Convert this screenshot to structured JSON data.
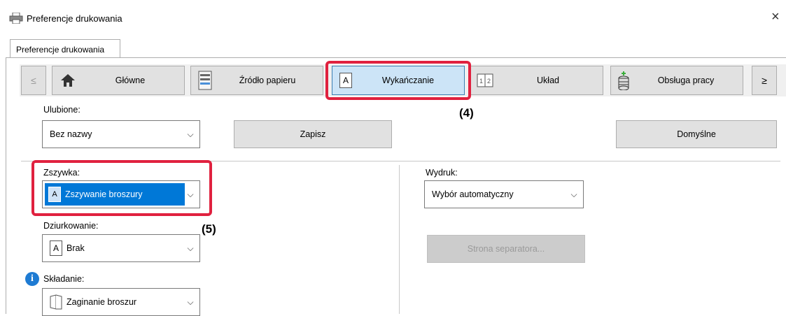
{
  "window": {
    "title": "Preferencje drukowania",
    "close_glyph": "×"
  },
  "tab": {
    "label": "Preferencje drukowania"
  },
  "nav": {
    "prev": "≤",
    "next": "≥",
    "items": [
      {
        "label": "Główne",
        "icon": "home-icon"
      },
      {
        "label": "Źródło papieru",
        "icon": "paper-tray-icon"
      },
      {
        "label": "Wykańczanie",
        "icon": "finishing-icon"
      },
      {
        "label": "Układ",
        "icon": "layout-icon"
      },
      {
        "label": "Obsługa pracy",
        "icon": "job-handling-icon"
      }
    ],
    "active_index": 2
  },
  "favorites": {
    "label": "Ulubione:",
    "value": "Bez nazwy",
    "save_button": "Zapisz",
    "defaults_button": "Domyślne"
  },
  "staple": {
    "label": "Zszywka:",
    "value": "Zszywanie broszury"
  },
  "punch": {
    "label": "Dziurkowanie:",
    "value": "Brak"
  },
  "fold": {
    "label": "Składanie:",
    "value": "Zaginanie broszur"
  },
  "output": {
    "label": "Wydruk:",
    "value": "Wybór automatyczny",
    "separator_button": "Strona separatora..."
  },
  "callouts": {
    "c4": "(4)",
    "c5": "(5)"
  },
  "colors": {
    "highlight_red": "#e0213f",
    "selected_blue": "#0078d7",
    "active_tab": "#cce4f7"
  }
}
